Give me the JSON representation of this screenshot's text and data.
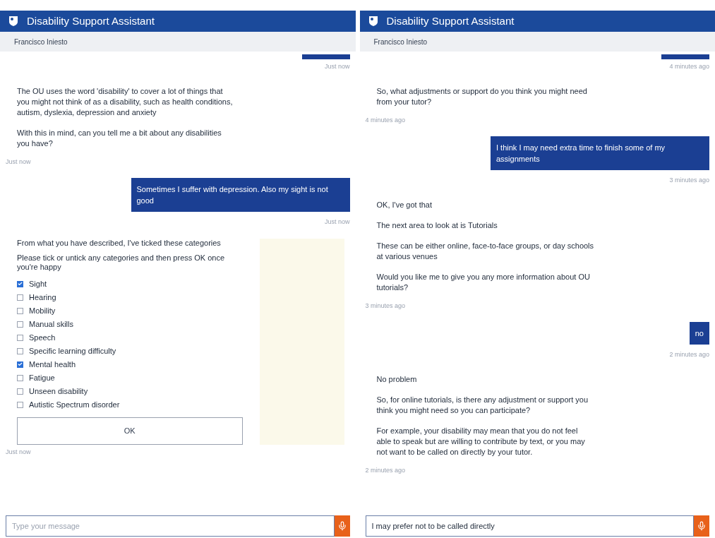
{
  "panels": [
    {
      "title": "Disability Support Assistant",
      "user_name": "Francisco Iniesto",
      "messages": [
        {
          "kind": "cut",
          "time": "Just now"
        },
        {
          "kind": "bot",
          "paragraphs": [
            "The OU uses the word 'disability' to cover a lot of things that you might not think of as a disability, such as health conditions, autism, dyslexia, depression and anxiety",
            "With this in mind, can you tell me a bit about any disabilities you have?"
          ],
          "time": "Just now"
        },
        {
          "kind": "user",
          "text": "Sometimes I suffer with depression. Also my sight is not good",
          "time": "Just now"
        },
        {
          "kind": "checklist",
          "paragraphs": [
            "From what you have described, I've ticked these categories",
            "Please tick or untick any categories and then press OK once you're happy"
          ],
          "options": [
            {
              "label": "Sight",
              "checked": true
            },
            {
              "label": "Hearing",
              "checked": false
            },
            {
              "label": "Mobility",
              "checked": false
            },
            {
              "label": "Manual skills",
              "checked": false
            },
            {
              "label": "Speech",
              "checked": false
            },
            {
              "label": "Specific learning difficulty",
              "checked": false
            },
            {
              "label": "Mental health",
              "checked": true
            },
            {
              "label": "Fatigue",
              "checked": false
            },
            {
              "label": "Unseen disability",
              "checked": false
            },
            {
              "label": "Autistic Spectrum disorder",
              "checked": false
            }
          ],
          "button": "OK",
          "time": "Just now"
        }
      ],
      "input": {
        "placeholder": "Type your message"
      }
    },
    {
      "title": "Disability Support Assistant",
      "user_name": "Francisco Iniesto",
      "messages": [
        {
          "kind": "cut",
          "time": "4 minutes ago"
        },
        {
          "kind": "bot",
          "paragraphs": [
            "So, what adjustments or support do you think you might need from your tutor?"
          ],
          "time": "4 minutes ago"
        },
        {
          "kind": "user",
          "text": "I think I may need extra time to finish some of my assignments",
          "time": "3 minutes ago"
        },
        {
          "kind": "bot",
          "paragraphs": [
            "OK, I've got that",
            "The next area to look at is Tutorials",
            "These can be either online, face-to-face groups, or day schools at various venues",
            "Would you like me to give you any more information about OU tutorials?"
          ],
          "time": "3 minutes ago"
        },
        {
          "kind": "user",
          "text": "no",
          "time": "2 minutes ago"
        },
        {
          "kind": "bot",
          "paragraphs": [
            "No problem",
            "So, for online tutorials, is there any adjustment or support you think you might need so you can participate?",
            "For example, your disability may mean that you do not feel able to speak but are willing to contribute by text, or you may not want to be called on directly by your tutor."
          ],
          "time": "2 minutes ago"
        }
      ],
      "input": {
        "value": "I may prefer not to be called directly"
      }
    }
  ]
}
